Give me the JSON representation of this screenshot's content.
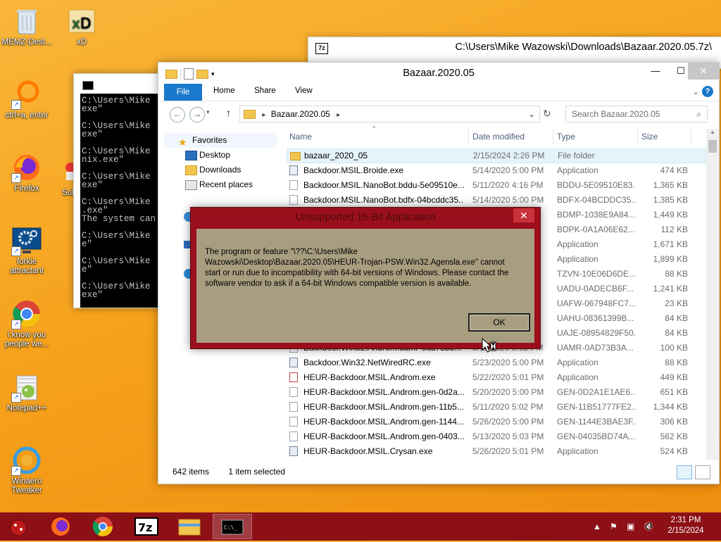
{
  "desktop": {
    "icons": [
      {
        "label": "MEMZ-Dest...",
        "icon": "recycle-bin-icon"
      },
      {
        "label": "xD",
        "icon": "xd-icon"
      },
      {
        "label": "ctrl+a, enter",
        "icon": "magnifier-icon"
      },
      {
        "label": "Firefox",
        "icon": "firefox-icon"
      },
      {
        "label": "Sulf",
        "icon": "app-icon"
      },
      {
        "label": "forkie attractant",
        "icon": "gear-monitor-icon"
      },
      {
        "label": "i know you people we...",
        "icon": "chrome-icon"
      },
      {
        "label": "Notepad++",
        "icon": "notepad-plus-plus-icon"
      },
      {
        "label": "Winaero Tweaker",
        "icon": "winaero-icon"
      }
    ]
  },
  "console": {
    "lines": [
      "C:\\Users\\Mike",
      "exe\"",
      "",
      "C:\\Users\\Mike",
      "exe\"",
      "",
      "C:\\Users\\Mike",
      "nix.exe\"",
      "",
      "C:\\Users\\Mike",
      "exe\"",
      "",
      "C:\\Users\\Mike",
      ".exe\"",
      "The system can",
      "",
      "C:\\Users\\Mike",
      "e\"",
      "",
      "C:\\Users\\Mike",
      "e\"",
      "",
      "C:\\Users\\Mike",
      "exe\""
    ]
  },
  "sevenzip": {
    "icon_label": "7z",
    "title": "C:\\Users\\Mike Wazowski\\Downloads\\Bazaar.2020.05.7z\\"
  },
  "explorer": {
    "title": "Bazaar.2020.05",
    "ribbon": {
      "file": "File",
      "home": "Home",
      "share": "Share",
      "view": "View",
      "help": "?"
    },
    "address": "Bazaar.2020.05",
    "search_placeholder": "Search Bazaar.2020.05",
    "nav": {
      "favorites": "Favorites",
      "desktop": "Desktop",
      "downloads": "Downloads",
      "recent": "Recent places"
    },
    "columns": {
      "name": "Name",
      "date": "Date modified",
      "type": "Type",
      "size": "Size"
    },
    "rows": [
      {
        "name": "bazaar_2020_05",
        "date": "2/15/2024 2:26 PM",
        "type": "File folder",
        "size": "",
        "kind": "folder"
      },
      {
        "name": "Backdoor.MSIL.Broide.exe",
        "date": "5/14/2020 5:00 PM",
        "type": "Application",
        "size": "474 KB",
        "kind": "app"
      },
      {
        "name": "Backdoor.MSIL.NanoBot.bddu-5e09510e...",
        "date": "5/11/2020 4:16 PM",
        "type": "BDDU-5E09510E83...",
        "size": "1,365 KB",
        "kind": "file"
      },
      {
        "name": "Backdoor.MSIL.NanoBot.bdfx-04bcddc35...",
        "date": "5/14/2020 5:00 PM",
        "type": "BDFX-04BCDDC35...",
        "size": "1,385 KB",
        "kind": "file"
      },
      {
        "name": "",
        "date": "",
        "type": "BDMP-1038E9A84...",
        "size": "1,449 KB",
        "kind": "file"
      },
      {
        "name": "",
        "date": "",
        "type": "BDPK-0A1A06E62...",
        "size": "112 KB",
        "kind": "file"
      },
      {
        "name": "",
        "date": "",
        "type": "Application",
        "size": "1,671 KB",
        "kind": "app"
      },
      {
        "name": "",
        "date": "",
        "type": "Application",
        "size": "1,899 KB",
        "kind": "app"
      },
      {
        "name": "",
        "date": "",
        "type": "TZVN-10E06D6DE...",
        "size": "88 KB",
        "kind": "file"
      },
      {
        "name": "",
        "date": "",
        "type": "UADU-0ADECB6F...",
        "size": "1,241 KB",
        "kind": "file"
      },
      {
        "name": "",
        "date": "",
        "type": "UAFW-067948FC7...",
        "size": "23 KB",
        "kind": "file"
      },
      {
        "name": "",
        "date": "",
        "type": "UAHU-08361399B...",
        "size": "84 KB",
        "kind": "file"
      },
      {
        "name": "",
        "date": "",
        "type": "UAJE-08954829F50...",
        "size": "84 KB",
        "kind": "file"
      },
      {
        "name": "Backdoor.Win32.Androm.uamr-0ad73b3...",
        "date": "5/11/2020 5:02 PM",
        "type": "UAMR-0AD73B3A...",
        "size": "100 KB",
        "kind": "file"
      },
      {
        "name": "Backdoor.Win32.NetWiredRC.exe",
        "date": "5/23/2020 5:00 PM",
        "type": "Application",
        "size": "88 KB",
        "kind": "app"
      },
      {
        "name": "HEUR-Backdoor.MSIL.Androm.exe",
        "date": "5/22/2020 5:01 PM",
        "type": "Application",
        "size": "449 KB",
        "kind": "note"
      },
      {
        "name": "HEUR-Backdoor.MSIL.Androm.gen-0d2a...",
        "date": "5/20/2020 5:00 PM",
        "type": "GEN-0D2A1E1AE6...",
        "size": "651 KB",
        "kind": "file"
      },
      {
        "name": "HEUR-Backdoor.MSIL.Androm.gen-11b5...",
        "date": "5/11/2020 5:02 PM",
        "type": "GEN-11B51777FE2...",
        "size": "1,344 KB",
        "kind": "file"
      },
      {
        "name": "HEUR-Backdoor.MSIL.Androm.gen-1144...",
        "date": "5/26/2020 5:00 PM",
        "type": "GEN-1144E3BAE3F...",
        "size": "306 KB",
        "kind": "file"
      },
      {
        "name": "HEUR-Backdoor.MSIL.Androm.gen-0403...",
        "date": "5/13/2020 5:03 PM",
        "type": "GEN-04035BD74A...",
        "size": "562 KB",
        "kind": "file"
      },
      {
        "name": "HEUR-Backdoor.MSIL.Crysan.exe",
        "date": "5/26/2020 5:01 PM",
        "type": "Application",
        "size": "524 KB",
        "kind": "app"
      }
    ],
    "status": {
      "items": "642 items",
      "selected": "1 item selected"
    }
  },
  "dialog": {
    "title": "Unsupported 16-Bit Application",
    "message": "The program or feature \"\\??\\C:\\Users\\Mike Wazowski\\Desktop\\Bazaar.2020.05\\HEUR-Trojan-PSW.Win32.Agensla.exe\" cannot start or run due to incompatibility with 64-bit versions of Windows. Please contact the software vendor to ask if a 64-bit Windows compatible version is available.",
    "ok": "OK",
    "close": "✕"
  },
  "taskbar": {
    "apps": [
      "memz-icon",
      "firefox-icon",
      "chrome-icon",
      "7zip-icon",
      "explorer-icon",
      "console-icon"
    ],
    "active_app": "console-icon",
    "time": "2:31 PM",
    "date": "2/15/2024"
  },
  "colors": {
    "taskbar": "#8c1016",
    "accent": "#1979ca",
    "dialog_frame": "#9b0f1c",
    "dialog_body": "#a89d7f"
  }
}
